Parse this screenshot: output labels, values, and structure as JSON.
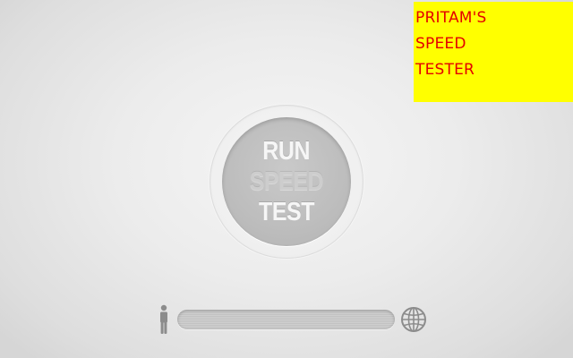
{
  "branding": {
    "lines": [
      "PRITAM'S",
      "SPEED",
      "TESTER"
    ]
  },
  "test_button": {
    "line1": "RUN",
    "line2": "SPEED",
    "line3": "TEST"
  },
  "progress": {
    "value": 0
  },
  "icons": {
    "left": "person-icon",
    "right": "globe-icon"
  },
  "colors": {
    "brand_background": "#ffff00",
    "brand_text": "#e40000",
    "button_face": "#bdbdbd",
    "button_text": "#f6f6f6",
    "button_text_muted": "#cdcdcd"
  }
}
